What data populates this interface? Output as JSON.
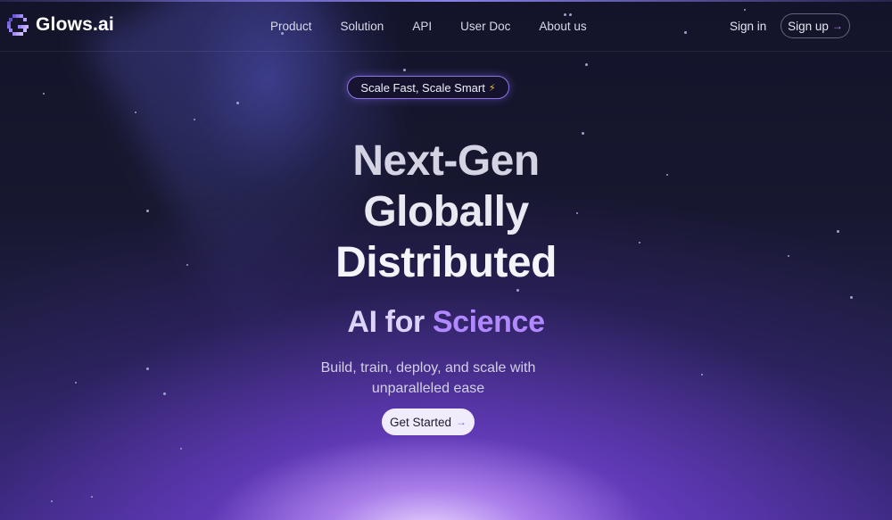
{
  "brand": {
    "name": "Glows.ai",
    "accent": "#9b6cff"
  },
  "nav": {
    "items": [
      {
        "label": "Product"
      },
      {
        "label": "Solution"
      },
      {
        "label": "API"
      },
      {
        "label": "User Doc"
      },
      {
        "label": "About us"
      }
    ],
    "sign_in": "Sign in",
    "sign_up": "Sign up",
    "arrow": "→"
  },
  "hero": {
    "badge": "Scale Fast, Scale Smart",
    "badge_icon": "⚡",
    "title_lines": [
      "Next-Gen",
      "Globally",
      "Distributed"
    ],
    "subhead_part1": "AI for",
    "subhead_part2": "Science",
    "description": "Build, train, deploy, and scale with unparalleled ease",
    "cta": "Get Started",
    "cta_arrow": "→"
  }
}
